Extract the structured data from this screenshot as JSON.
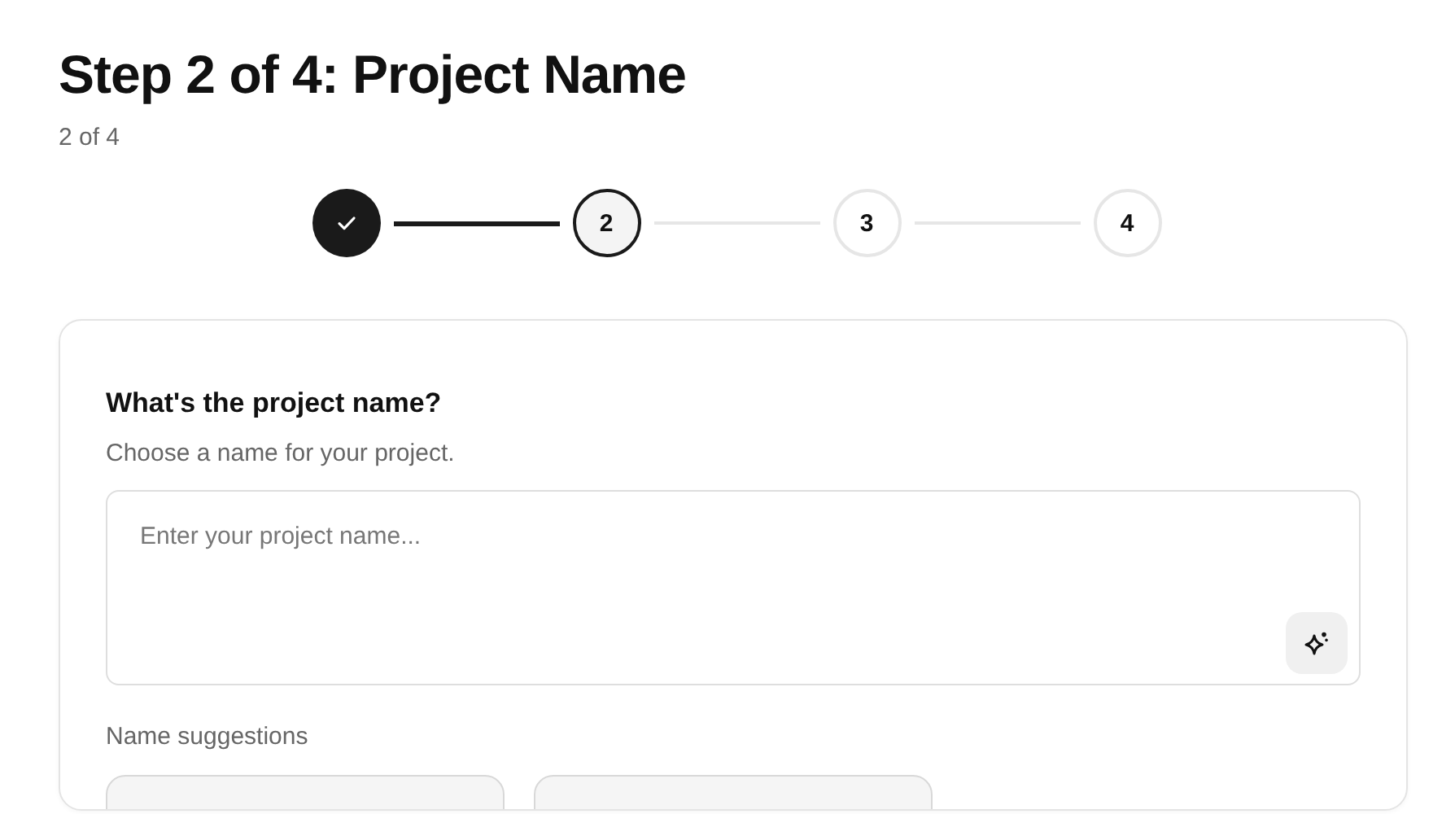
{
  "title": "Step 2 of 4: Project Name",
  "subtitle": "2 of 4",
  "steps": [
    {
      "completed": true,
      "selected": false
    },
    {
      "completed": false,
      "selected": true,
      "label": "2"
    },
    {
      "completed": false,
      "selected": false,
      "label": "3"
    },
    {
      "completed": false,
      "selected": false,
      "label": "4"
    }
  ],
  "card": {
    "heading": "What's the project name?",
    "description": "Choose a name for your project.",
    "input": {
      "placeholder": "Enter your project name..."
    },
    "suggestions_label": "Name suggestions",
    "suggestions": [
      {
        "kind": "chip"
      },
      {
        "kind": "chip"
      }
    ]
  }
}
